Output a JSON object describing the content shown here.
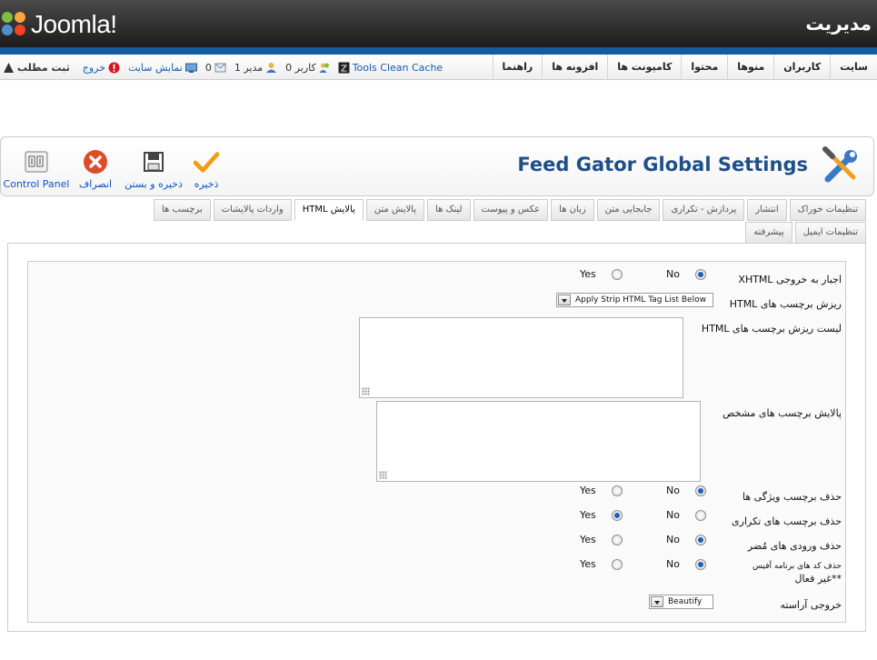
{
  "header": {
    "logo_text": "Joomla!",
    "admin_title": "مدیریت"
  },
  "menu": {
    "items": [
      {
        "label": "سایت"
      },
      {
        "label": "کاربران"
      },
      {
        "label": "منوها"
      },
      {
        "label": "محتوا"
      },
      {
        "label": "کامپونت ها"
      },
      {
        "label": "افزونه ها"
      },
      {
        "label": "راهنما"
      }
    ]
  },
  "status": {
    "cache_label": "Tools Clean Cache",
    "users_count": "0",
    "users_label": "کاربر",
    "admins_count": "1",
    "admins_label": "مدیر",
    "messages_count": "0",
    "view_site": "نمایش سایت",
    "logout": "خروج",
    "preview_cut": "ثبت مطلب"
  },
  "toolbar": {
    "title": "Feed Gator Global Settings",
    "save": "ذخیره",
    "save_close": "ذخیره و بستن",
    "cancel": "انصراف",
    "control_panel": "Control Panel"
  },
  "tabs": {
    "row1": [
      "تنظیمات خوراک",
      "انتشار",
      "پردازش - تکراری",
      "جابجایی متن",
      "زبان ها",
      "عکس و پیوست",
      "لینک ها",
      "پالایش متن",
      "پالایش HTML",
      "واردات پالایشات",
      "برچسب ها"
    ],
    "row2": [
      "تنظیمات ایمیل",
      "پیشرفته"
    ],
    "active": "پالایش HTML"
  },
  "form": {
    "yes": "Yes",
    "no": "No",
    "force_xhtml": {
      "label": "اجبار به خروجی XHTML",
      "value": "No"
    },
    "strip_html": {
      "label": "ریزش برچسب های HTML",
      "value": "Apply Strip HTML Tag List Below"
    },
    "strip_list": {
      "label": "لیست ریزش برچسب های HTML",
      "value": ""
    },
    "filter_tags": {
      "label": "پالایش برچسب های مشخص",
      "value": ""
    },
    "remove_attrs": {
      "label": "حذف برچسب ویژگی ها",
      "value": "No"
    },
    "remove_dupes": {
      "label": "حذف برچسب های تکراری",
      "value": "Yes"
    },
    "remove_harmful": {
      "label": "حذف ورودی های مُضر",
      "value": "No"
    },
    "remove_office": {
      "label": "حذف کد های برنامه آفیس",
      "label2": "**غیر فعال",
      "value": "No"
    },
    "beautify": {
      "label": "خروجی آراسته",
      "value": "Beautify"
    }
  }
}
